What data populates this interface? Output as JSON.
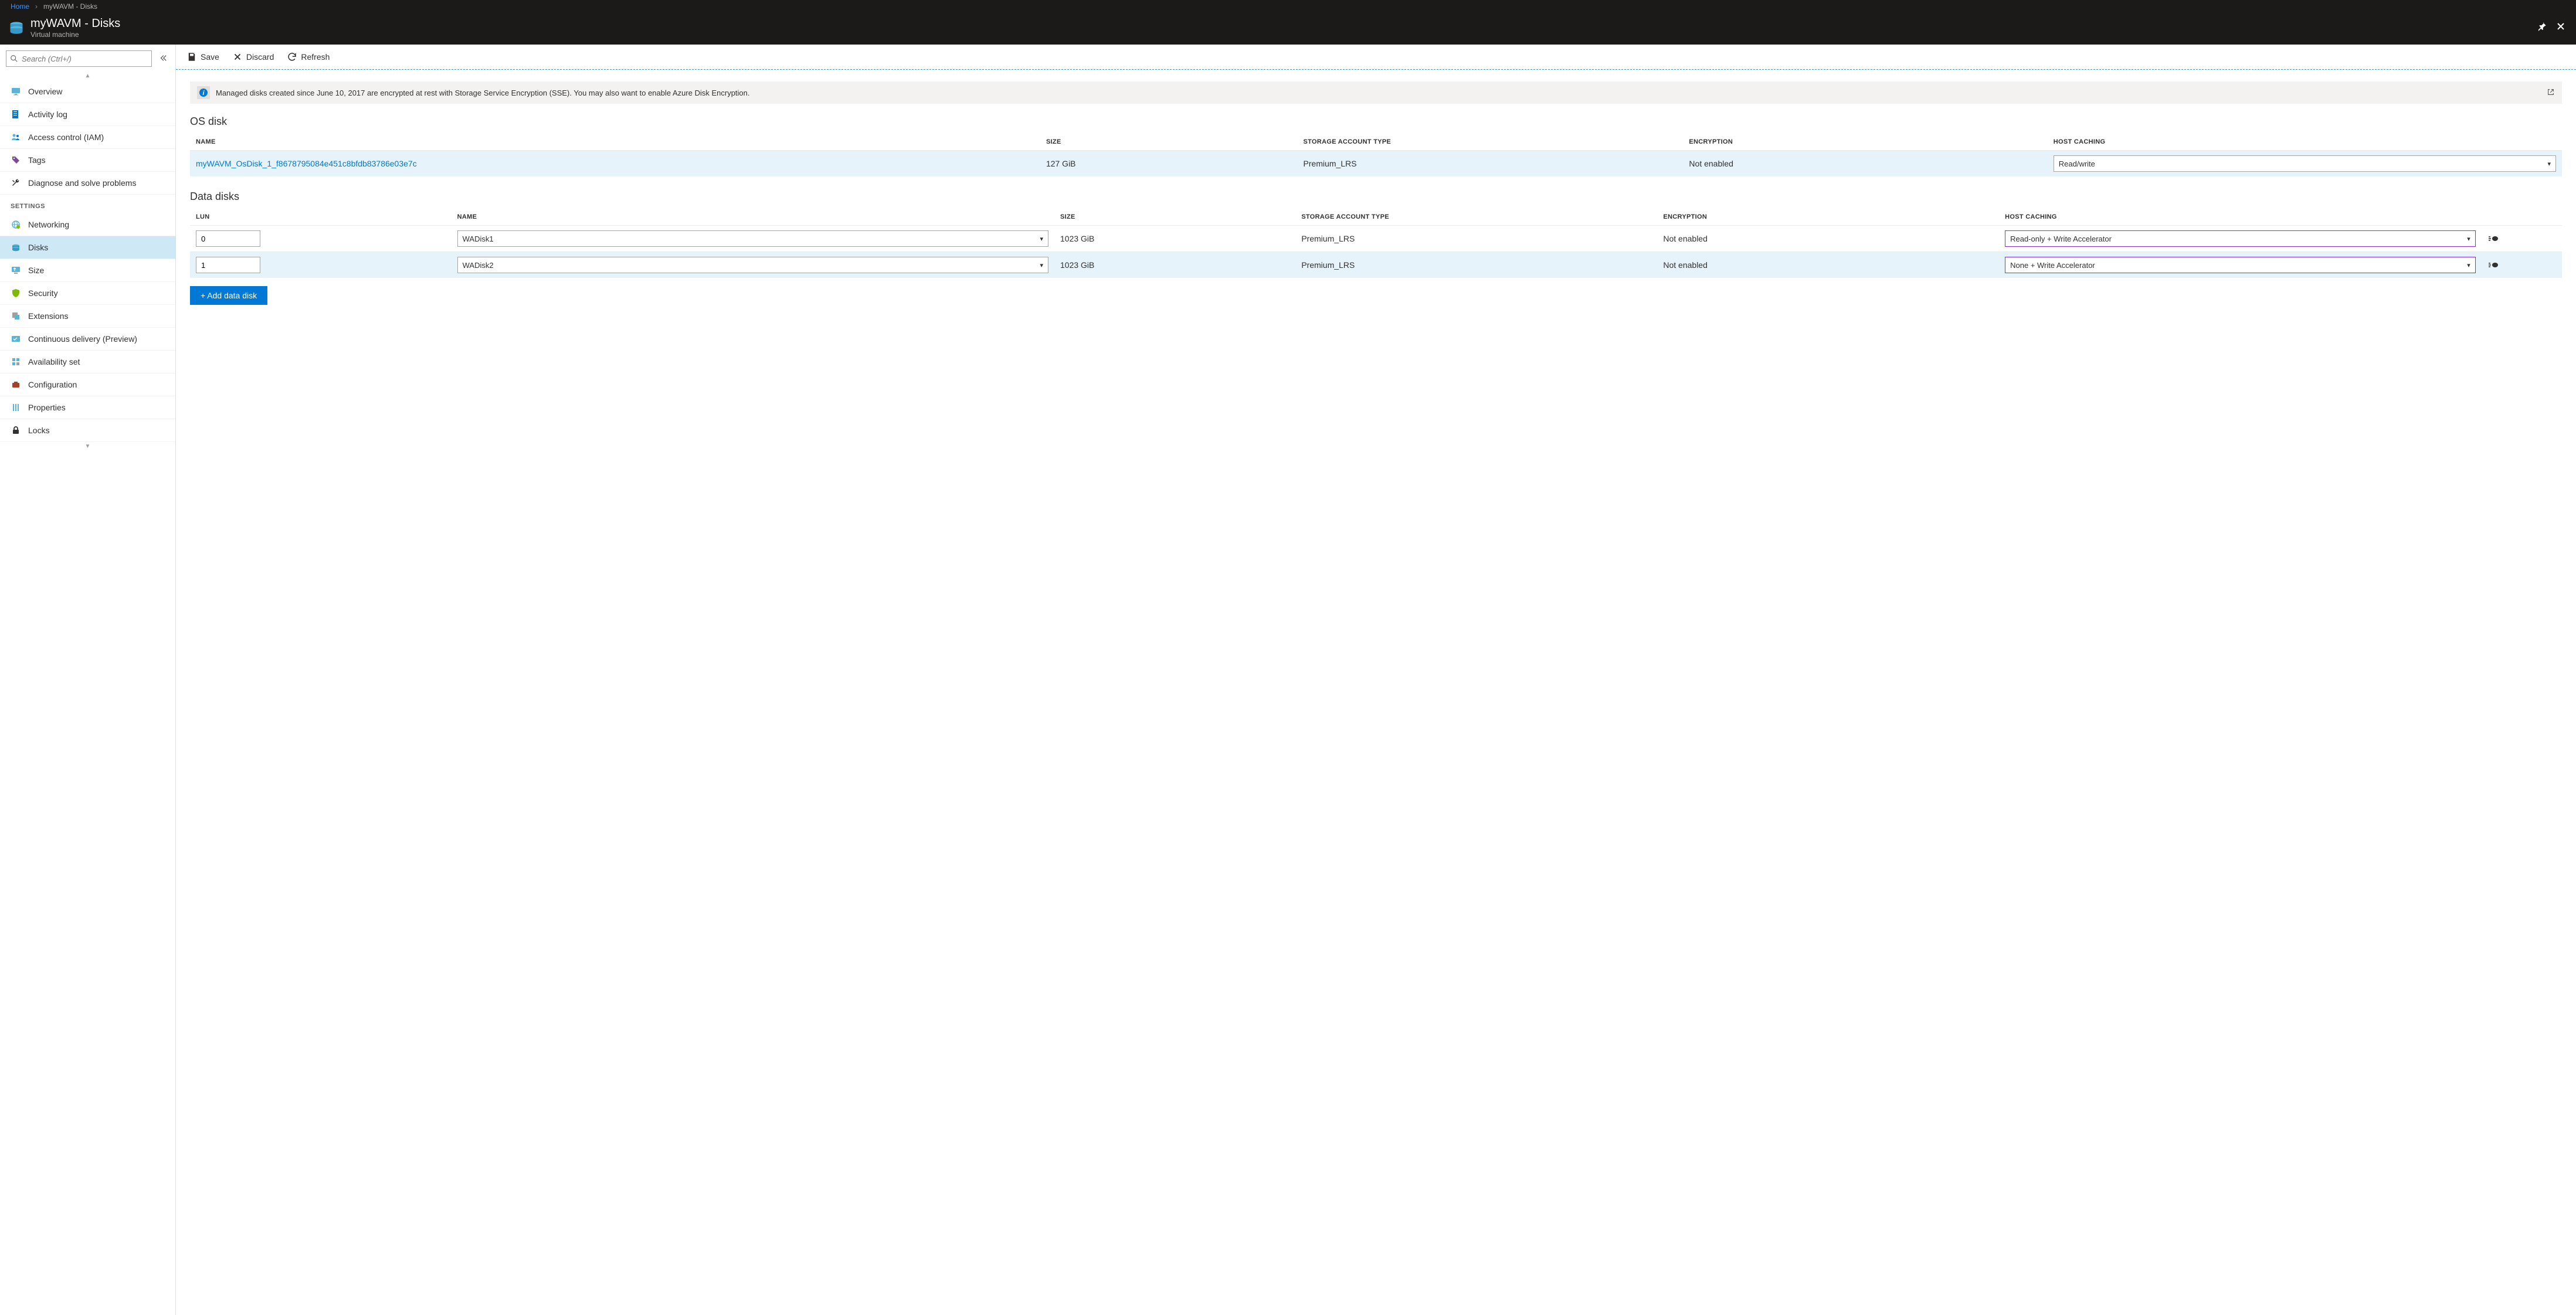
{
  "breadcrumb": {
    "home": "Home",
    "current": "myWAVM - Disks"
  },
  "header": {
    "title": "myWAVM - Disks",
    "subtitle": "Virtual machine"
  },
  "search": {
    "placeholder": "Search (Ctrl+/)"
  },
  "nav": {
    "items_top": [
      {
        "label": "Overview",
        "icon": "monitor"
      },
      {
        "label": "Activity log",
        "icon": "log"
      },
      {
        "label": "Access control (IAM)",
        "icon": "iam"
      },
      {
        "label": "Tags",
        "icon": "tag"
      },
      {
        "label": "Diagnose and solve problems",
        "icon": "wrench"
      }
    ],
    "section_label": "SETTINGS",
    "items_settings": [
      {
        "label": "Networking",
        "icon": "network"
      },
      {
        "label": "Disks",
        "icon": "disks",
        "selected": true
      },
      {
        "label": "Size",
        "icon": "size"
      },
      {
        "label": "Security",
        "icon": "shield"
      },
      {
        "label": "Extensions",
        "icon": "ext"
      },
      {
        "label": "Continuous delivery (Preview)",
        "icon": "cd"
      },
      {
        "label": "Availability set",
        "icon": "avail"
      },
      {
        "label": "Configuration",
        "icon": "config"
      },
      {
        "label": "Properties",
        "icon": "props"
      },
      {
        "label": "Locks",
        "icon": "lock"
      }
    ]
  },
  "toolbar": {
    "save": "Save",
    "discard": "Discard",
    "refresh": "Refresh"
  },
  "banner": {
    "message": "Managed disks created since June 10, 2017 are encrypted at rest with Storage Service Encryption (SSE). You may also want to enable Azure Disk Encryption."
  },
  "os_section": {
    "title": "OS disk",
    "columns": {
      "name": "NAME",
      "size": "SIZE",
      "sat": "STORAGE ACCOUNT TYPE",
      "enc": "ENCRYPTION",
      "hc": "HOST CACHING"
    },
    "row": {
      "name": "myWAVM_OsDisk_1_f8678795084e451c8bfdb83786e03e7c",
      "size": "127 GiB",
      "sat": "Premium_LRS",
      "enc": "Not enabled",
      "hc": "Read/write"
    }
  },
  "data_section": {
    "title": "Data disks",
    "columns": {
      "lun": "LUN",
      "name": "NAME",
      "size": "SIZE",
      "sat": "STORAGE ACCOUNT TYPE",
      "enc": "ENCRYPTION",
      "hc": "HOST CACHING"
    },
    "rows": [
      {
        "lun": "0",
        "name": "WADisk1",
        "size": "1023 GiB",
        "sat": "Premium_LRS",
        "enc": "Not enabled",
        "hc": "Read-only + Write Accelerator",
        "highlight": false
      },
      {
        "lun": "1",
        "name": "WADisk2",
        "size": "1023 GiB",
        "sat": "Premium_LRS",
        "enc": "Not enabled",
        "hc": "None + Write Accelerator",
        "highlight": true
      }
    ],
    "add_label": "+ Add data disk"
  }
}
